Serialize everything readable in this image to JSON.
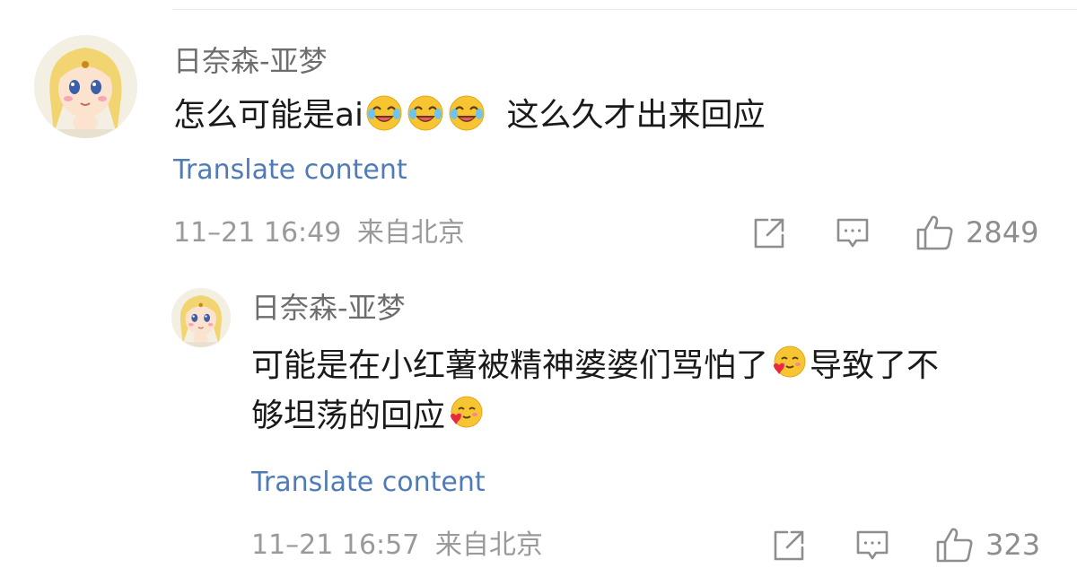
{
  "comments": [
    {
      "username": "日奈森-亚梦",
      "text_before": "怎么可能是ai",
      "emojis": [
        "laugh-cry-emoji",
        "laugh-cry-emoji",
        "laugh-cry-emoji"
      ],
      "text_after": "这么久才出来回应",
      "translate_label": "Translate content",
      "timestamp": "11–21 16:49",
      "location": "来自北京",
      "like_count": "2849"
    },
    {
      "username": "日奈森-亚梦",
      "line1": "可能是在小红薯被精神婆婆们骂怕了",
      "line1_after": "导致了不",
      "line2": "够坦荡的回应",
      "emoji": "shy-heart-emoji",
      "translate_label": "Translate content",
      "timestamp": "11–21 16:57",
      "location": "来自北京",
      "like_count": "323"
    }
  ],
  "icons": {
    "share": "share-icon",
    "reply": "comment-icon",
    "like": "thumbs-up-icon"
  },
  "colors": {
    "link": "#4f7bb6",
    "meta": "#9a9a9a",
    "username": "#6d6d6d"
  }
}
